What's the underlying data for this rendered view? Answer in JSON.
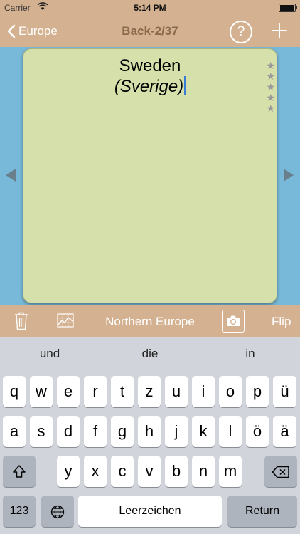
{
  "status_bar": {
    "carrier": "Carrier",
    "time": "5:14 PM"
  },
  "nav": {
    "back_label": "Europe",
    "title": "Back-2/37",
    "help_label": "?"
  },
  "card": {
    "title": "Sweden",
    "subtitle": "(Sverige)",
    "rating_max": 5,
    "rating": 0
  },
  "toolbar": {
    "category": "Northern Europe",
    "flip_label": "Flip"
  },
  "suggestions": [
    "und",
    "die",
    "in"
  ],
  "keyboard": {
    "row1": [
      "q",
      "w",
      "e",
      "r",
      "t",
      "z",
      "u",
      "i",
      "o",
      "p",
      "ü"
    ],
    "row2": [
      "a",
      "s",
      "d",
      "f",
      "g",
      "h",
      "j",
      "k",
      "l",
      "ö",
      "ä"
    ],
    "row3": [
      "y",
      "x",
      "c",
      "v",
      "b",
      "n",
      "m"
    ],
    "numbers_label": "123",
    "space_label": "Leerzeichen",
    "return_label": "Return"
  },
  "colors": {
    "bar": "#d4b190",
    "background": "#78b8d8",
    "card": "#d5e0aa",
    "title_text": "#8a6a4d"
  }
}
